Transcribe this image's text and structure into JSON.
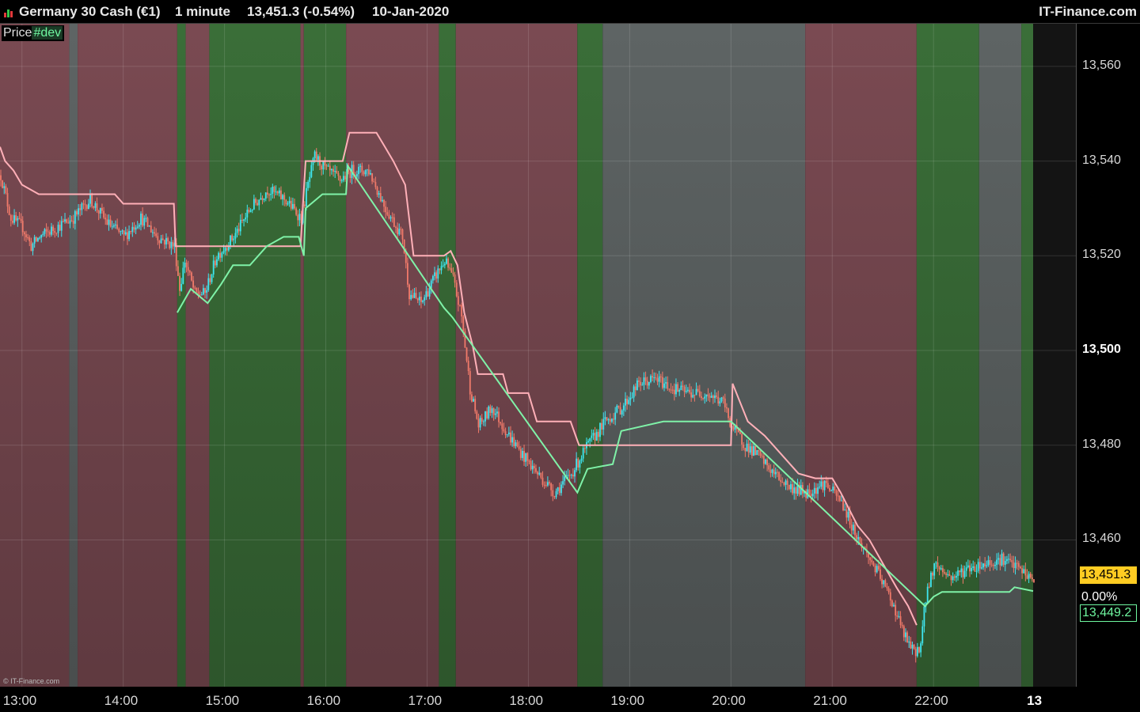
{
  "header": {
    "instrument": "Germany 30 Cash (€1)",
    "timeframe": "1 minute",
    "price_change": "13,451.3 (-0.54%)",
    "date": "10-Jan-2020",
    "brand": "IT-Finance.com"
  },
  "price_label": "Price",
  "dev_label": "#dev",
  "copyright": "© IT-Finance.com",
  "right_scale": {
    "last_price": "13,451.3",
    "percent": "0.00%",
    "dev_value": "13,449.2"
  },
  "colors": {
    "bull_candle": "#3fe6f0",
    "bear_candle": "#f07a6a",
    "upper_line": "#ffb0b8",
    "lower_line": "#7ff2a8",
    "zone_red": "#7a4a52",
    "zone_green": "#3a6e38",
    "zone_grey": "#5e6464",
    "last_price_bg": "#ffcc22"
  },
  "chart_data": {
    "type": "candlestick",
    "instrument": "Germany 30 Cash (€1)",
    "x_axis": {
      "unit": "time",
      "range": [
        "12:47",
        "22:59"
      ],
      "ticks": [
        "13:00",
        "14:00",
        "15:00",
        "16:00",
        "17:00",
        "18:00",
        "19:00",
        "20:00",
        "21:00",
        "22:00",
        "13"
      ]
    },
    "y_axis": {
      "range": [
        13429,
        13569
      ],
      "ticks": [
        "13,460",
        "13,480",
        "13,500",
        "13,520",
        "13,540",
        "13,560"
      ],
      "bold_tick": "13,500"
    },
    "grid": true,
    "background_zones": [
      {
        "start": "12:47",
        "end": "13:28",
        "state": "red"
      },
      {
        "start": "13:28",
        "end": "13:33",
        "state": "grey"
      },
      {
        "start": "13:33",
        "end": "14:32",
        "state": "red"
      },
      {
        "start": "14:32",
        "end": "14:37",
        "state": "green"
      },
      {
        "start": "14:37",
        "end": "14:51",
        "state": "red"
      },
      {
        "start": "14:51",
        "end": "15:45",
        "state": "green"
      },
      {
        "start": "15:45",
        "end": "15:47",
        "state": "red"
      },
      {
        "start": "15:47",
        "end": "16:12",
        "state": "green"
      },
      {
        "start": "16:12",
        "end": "17:07",
        "state": "red"
      },
      {
        "start": "17:07",
        "end": "17:17",
        "state": "green"
      },
      {
        "start": "17:17",
        "end": "18:29",
        "state": "red"
      },
      {
        "start": "18:29",
        "end": "18:44",
        "state": "green"
      },
      {
        "start": "18:44",
        "end": "20:44",
        "state": "grey"
      },
      {
        "start": "20:44",
        "end": "21:50",
        "state": "red"
      },
      {
        "start": "21:50",
        "end": "22:27",
        "state": "green"
      },
      {
        "start": "22:27",
        "end": "22:52",
        "state": "grey"
      },
      {
        "start": "22:52",
        "end": "22:59",
        "state": "green"
      }
    ],
    "price_path": [
      [
        "12:47",
        13537
      ],
      [
        "12:53",
        13528
      ],
      [
        "13:00",
        13526
      ],
      [
        "13:05",
        13522
      ],
      [
        "13:10",
        13524
      ],
      [
        "13:20",
        13526
      ],
      [
        "13:30",
        13528
      ],
      [
        "13:40",
        13532
      ],
      [
        "13:50",
        13527
      ],
      [
        "14:00",
        13524
      ],
      [
        "14:10",
        13528
      ],
      [
        "14:20",
        13524
      ],
      [
        "14:30",
        13522
      ],
      [
        "14:33",
        13513
      ],
      [
        "14:36",
        13519
      ],
      [
        "14:42",
        13512
      ],
      [
        "14:48",
        13512
      ],
      [
        "14:55",
        13520
      ],
      [
        "15:05",
        13524
      ],
      [
        "15:15",
        13530
      ],
      [
        "15:25",
        13534
      ],
      [
        "15:35",
        13532
      ],
      [
        "15:45",
        13528
      ],
      [
        "15:49",
        13535
      ],
      [
        "15:53",
        13541
      ],
      [
        "16:00",
        13538
      ],
      [
        "16:08",
        13536
      ],
      [
        "16:15",
        13538
      ],
      [
        "16:25",
        13538
      ],
      [
        "16:35",
        13530
      ],
      [
        "16:45",
        13524
      ],
      [
        "16:49",
        13512
      ],
      [
        "16:56",
        13510
      ],
      [
        "17:05",
        13516
      ],
      [
        "17:10",
        13519
      ],
      [
        "17:15",
        13515
      ],
      [
        "17:20",
        13507
      ],
      [
        "17:25",
        13492
      ],
      [
        "17:30",
        13484
      ],
      [
        "17:38",
        13488
      ],
      [
        "17:48",
        13482
      ],
      [
        "17:56",
        13478
      ],
      [
        "18:05",
        13474
      ],
      [
        "18:15",
        13470
      ],
      [
        "18:25",
        13474
      ],
      [
        "18:33",
        13479
      ],
      [
        "18:45",
        13485
      ],
      [
        "18:55",
        13488
      ],
      [
        "19:05",
        13493
      ],
      [
        "19:15",
        13494
      ],
      [
        "19:25",
        13492
      ],
      [
        "19:35",
        13491
      ],
      [
        "19:45",
        13491
      ],
      [
        "19:55",
        13489
      ],
      [
        "20:00",
        13484
      ],
      [
        "20:08",
        13480
      ],
      [
        "20:15",
        13478
      ],
      [
        "20:25",
        13474
      ],
      [
        "20:35",
        13471
      ],
      [
        "20:45",
        13470
      ],
      [
        "20:55",
        13472
      ],
      [
        "21:05",
        13468
      ],
      [
        "21:15",
        13460
      ],
      [
        "21:25",
        13454
      ],
      [
        "21:35",
        13447
      ],
      [
        "21:42",
        13440
      ],
      [
        "21:48",
        13436
      ],
      [
        "21:52",
        13438
      ],
      [
        "21:55",
        13448
      ],
      [
        "22:00",
        13455
      ],
      [
        "22:10",
        13452
      ],
      [
        "22:20",
        13454
      ],
      [
        "22:30",
        13455
      ],
      [
        "22:40",
        13456
      ],
      [
        "22:50",
        13454
      ],
      [
        "22:59",
        13451.3
      ]
    ],
    "upper_band": [
      [
        "12:47",
        13543
      ],
      [
        "12:50",
        13540
      ],
      [
        "12:55",
        13538
      ],
      [
        "13:00",
        13535
      ],
      [
        "13:10",
        13533
      ],
      [
        "13:30",
        13533
      ],
      [
        "13:55",
        13533
      ],
      [
        "14:00",
        13531
      ],
      [
        "14:30",
        13531
      ],
      [
        "14:31",
        13522
      ],
      [
        "14:48",
        13522
      ],
      [
        "15:45",
        13522
      ],
      [
        "15:48",
        13540
      ],
      [
        "16:00",
        13540
      ],
      [
        "16:10",
        13540
      ],
      [
        "16:14",
        13546
      ],
      [
        "16:30",
        13546
      ],
      [
        "16:35",
        13543
      ],
      [
        "16:40",
        13540
      ],
      [
        "16:47",
        13535
      ],
      [
        "16:52",
        13520
      ],
      [
        "17:10",
        13520
      ],
      [
        "17:14",
        13521
      ],
      [
        "17:18",
        13518
      ],
      [
        "17:22",
        13508
      ],
      [
        "17:27",
        13501
      ],
      [
        "17:30",
        13495
      ],
      [
        "17:45",
        13495
      ],
      [
        "17:48",
        13491
      ],
      [
        "18:00",
        13491
      ],
      [
        "18:05",
        13485
      ],
      [
        "18:25",
        13485
      ],
      [
        "18:30",
        13480
      ],
      [
        "20:00",
        13480
      ],
      [
        "20:01",
        13493
      ],
      [
        "20:10",
        13485
      ],
      [
        "20:20",
        13482
      ],
      [
        "20:30",
        13478
      ],
      [
        "20:40",
        13474
      ],
      [
        "20:50",
        13473
      ],
      [
        "21:00",
        13473
      ],
      [
        "21:05",
        13470
      ],
      [
        "21:15",
        13463
      ],
      [
        "21:22",
        13460
      ],
      [
        "21:30",
        13455
      ],
      [
        "21:38",
        13450
      ],
      [
        "21:45",
        13446
      ],
      [
        "21:50",
        13442
      ]
    ],
    "lower_band": [
      [
        "14:32",
        13508
      ],
      [
        "14:40",
        13513
      ],
      [
        "14:50",
        13510
      ],
      [
        "14:58",
        13514
      ],
      [
        "15:05",
        13518
      ],
      [
        "15:15",
        13518
      ],
      [
        "15:25",
        13522
      ],
      [
        "15:35",
        13524
      ],
      [
        "15:44",
        13524
      ],
      [
        "15:47",
        13520
      ],
      [
        "15:48",
        13530
      ],
      [
        "15:58",
        13533
      ],
      [
        "16:12",
        13533
      ],
      [
        "16:13",
        13539
      ],
      [
        "17:10",
        13509
      ],
      [
        "17:15",
        13507
      ],
      [
        "18:29",
        13470
      ],
      [
        "18:35",
        13475
      ],
      [
        "18:50",
        13476
      ],
      [
        "18:55",
        13483
      ],
      [
        "19:20",
        13485
      ],
      [
        "20:00",
        13485
      ],
      [
        "21:55",
        13446
      ],
      [
        "22:00",
        13448
      ],
      [
        "22:05",
        13449
      ],
      [
        "22:45",
        13449
      ],
      [
        "22:48",
        13450
      ],
      [
        "22:59",
        13449.2
      ]
    ],
    "last_price": 13451.3,
    "dev_value": 13449.2
  }
}
